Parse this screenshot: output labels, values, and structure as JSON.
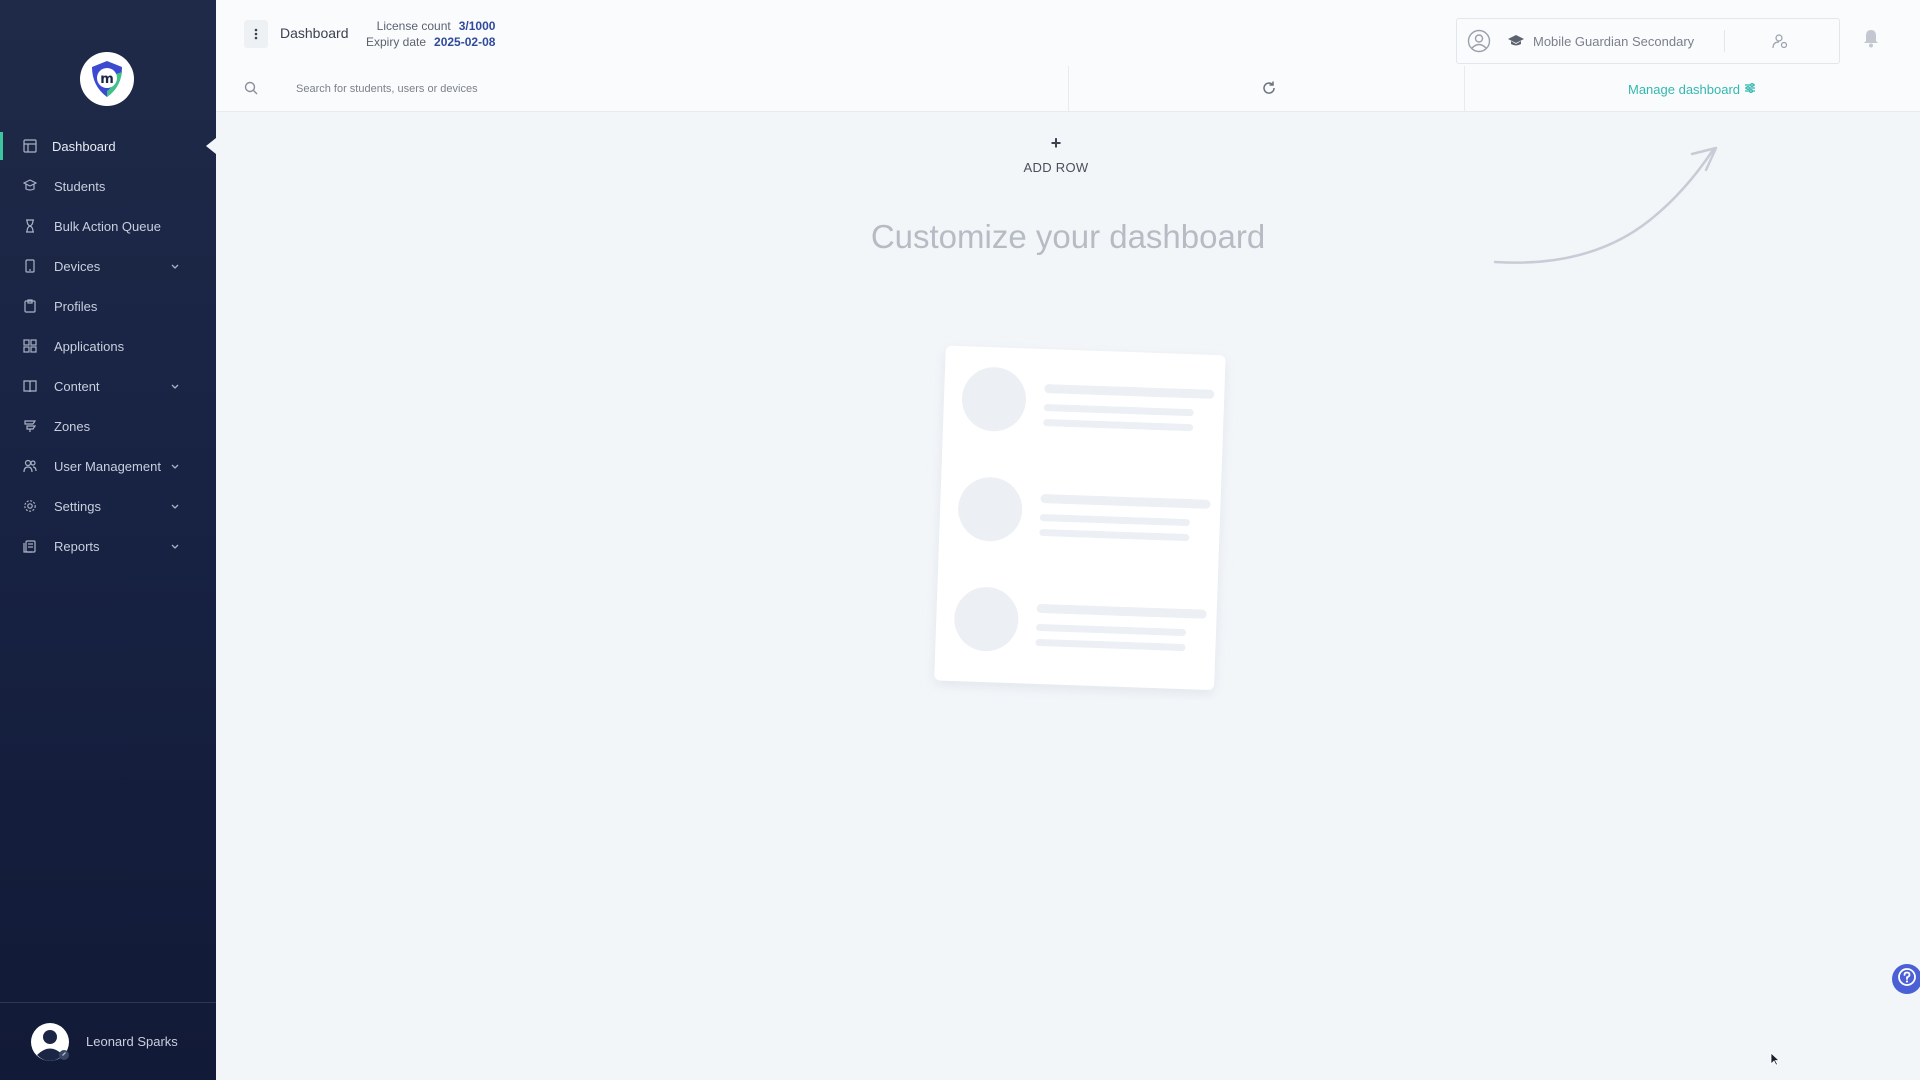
{
  "sidebar": {
    "logo_icon": "mobile-guardian-logo-icon",
    "items": [
      {
        "label": "Dashboard",
        "icon": "dashboard-icon",
        "active": true
      },
      {
        "label": "Students",
        "icon": "students-icon"
      },
      {
        "label": "Bulk Action Queue",
        "icon": "hourglass-icon"
      },
      {
        "label": "Devices",
        "icon": "device-icon",
        "expandable": true
      },
      {
        "label": "Profiles",
        "icon": "profiles-icon"
      },
      {
        "label": "Applications",
        "icon": "apps-grid-icon"
      },
      {
        "label": "Content",
        "icon": "content-icon",
        "expandable": true
      },
      {
        "label": "Zones",
        "icon": "zones-icon"
      },
      {
        "label": "User Management",
        "icon": "users-icon",
        "expandable": true
      },
      {
        "label": "Settings",
        "icon": "gear-icon",
        "expandable": true
      },
      {
        "label": "Reports",
        "icon": "reports-icon",
        "expandable": true
      }
    ],
    "user": {
      "name": "Leonard Sparks"
    }
  },
  "header": {
    "title": "Dashboard",
    "license_label": "License count",
    "license_value": "3/1000",
    "expiry_label": "Expiry date",
    "expiry_value": "2025-02-08",
    "organization": "Mobile Guardian Secondary"
  },
  "search": {
    "placeholder": "Search for students, users or devices"
  },
  "toolbar": {
    "manage_label": "Manage dashboard"
  },
  "main": {
    "add_row_symbol": "+",
    "add_row_label": "ADD ROW",
    "heading": "Customize your dashboard"
  },
  "colors": {
    "sidebar_bg": "#1b2545",
    "active_indicator": "#3bc6a0",
    "accent_teal": "#33b8b0",
    "license_value": "#2f4a9b",
    "help_button": "#4b5fd6"
  }
}
